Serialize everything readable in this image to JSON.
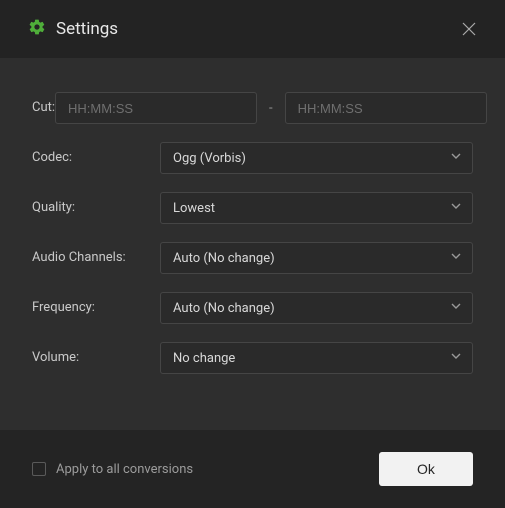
{
  "title": "Settings",
  "cut": {
    "label": "Cut:",
    "from_placeholder": "HH:MM:SS",
    "to_placeholder": "HH:MM:SS",
    "separator": "-"
  },
  "codec": {
    "label": "Codec:",
    "value": "Ogg (Vorbis)"
  },
  "quality": {
    "label": "Quality:",
    "value": "Lowest"
  },
  "audio_channels": {
    "label": "Audio Channels:",
    "value": "Auto (No change)"
  },
  "frequency": {
    "label": "Frequency:",
    "value": "Auto (No change)"
  },
  "volume": {
    "label": "Volume:",
    "value": "No change"
  },
  "footer": {
    "apply_all_label": "Apply to all conversions",
    "ok_label": "Ok"
  }
}
